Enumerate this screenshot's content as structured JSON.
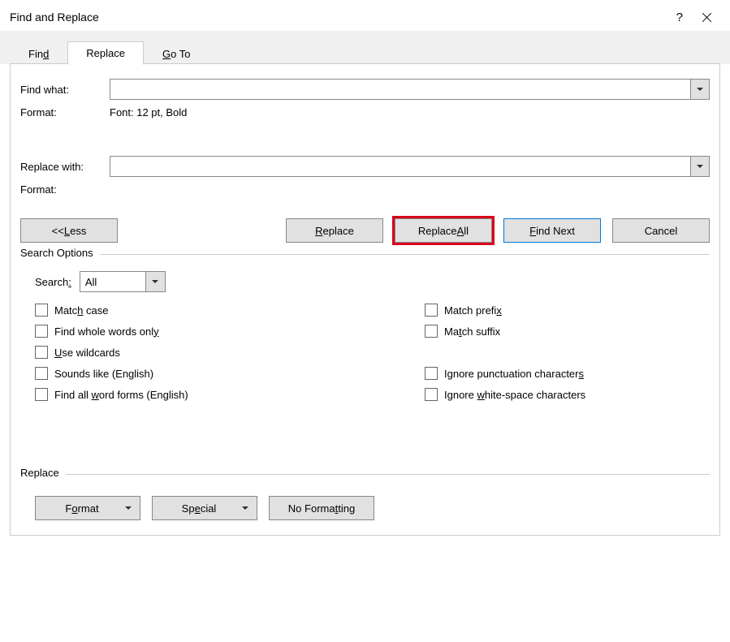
{
  "title": "Find and Replace",
  "tabs": {
    "find": "Find",
    "replace": "Replace",
    "goto": "Go To"
  },
  "labels": {
    "find_what": "Find what:",
    "format1": "Format:",
    "format1_value": "Font: 12 pt, Bold",
    "replace_with": "Replace with:",
    "format2": "Format:"
  },
  "buttons": {
    "less": "<< Less",
    "replace": "Replace",
    "replace_all": "Replace All",
    "find_next": "Find Next",
    "cancel": "Cancel",
    "format": "Format",
    "special": "Special",
    "no_formatting": "No Formatting"
  },
  "search_options": {
    "legend": "Search Options",
    "search_label": "Search:",
    "search_value": "All",
    "match_case": "Match case",
    "whole_words": "Find whole words only",
    "wildcards": "Use wildcards",
    "sounds_like": "Sounds like (English)",
    "word_forms": "Find all word forms (English)",
    "match_prefix": "Match prefix",
    "match_suffix": "Match suffix",
    "ignore_punct": "Ignore punctuation characters",
    "ignore_ws": "Ignore white-space characters"
  },
  "replace_legend": "Replace",
  "inputs": {
    "find_value": "",
    "replace_value": ""
  }
}
